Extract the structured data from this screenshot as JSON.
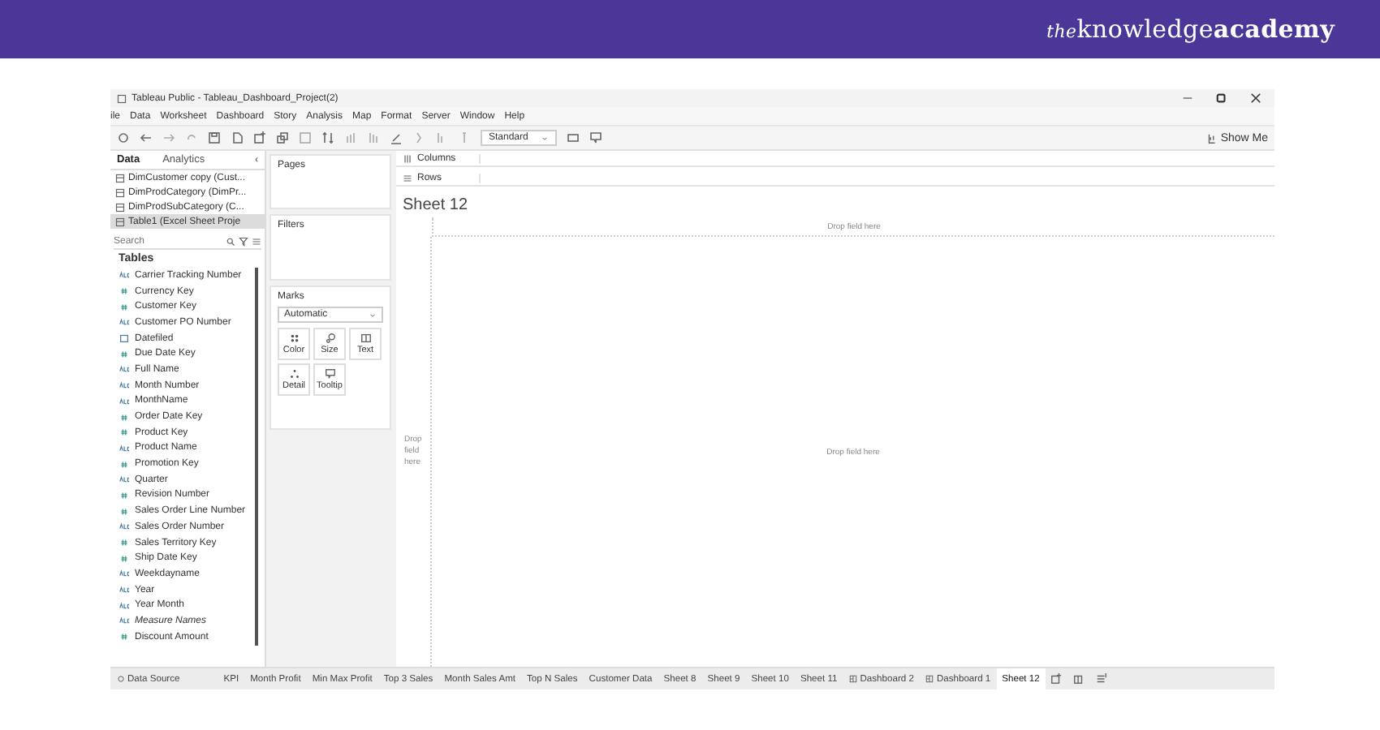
{
  "banner": {
    "logo": [
      {
        "text": "the",
        "kind": "italic"
      },
      {
        "text": "knowledge",
        "kind": "regular"
      },
      {
        "text": "academy",
        "kind": "bold"
      }
    ]
  },
  "window": {
    "title": "Tableau Public - Tableau_Dashboard_Project(2)"
  },
  "menu": [
    "ile",
    "Data",
    "Worksheet",
    "Dashboard",
    "Story",
    "Analysis",
    "Map",
    "Format",
    "Server",
    "Window",
    "Help"
  ],
  "toolbar": {
    "fit_dropdown": "Standard",
    "show_me": "Show Me"
  },
  "data_pane": {
    "tabs": [
      {
        "label": "Data",
        "selected": true
      },
      {
        "label": "Analytics",
        "selected": false
      }
    ],
    "collapse": "‹",
    "sources": [
      {
        "label": "DimCustomer copy (Cust...",
        "selected": false
      },
      {
        "label": "DimProdCategory (DimPr...",
        "selected": false
      },
      {
        "label": "DimProdSubCategory (C...",
        "selected": false
      },
      {
        "label": "Table1 (Excel Sheet Proje",
        "selected": true
      }
    ],
    "search": {
      "placeholder": "Search"
    },
    "tables_heading": "Tables",
    "fields": [
      {
        "label": "Carrier Tracking Number",
        "kind": "string"
      },
      {
        "label": "Currency Key",
        "kind": "number"
      },
      {
        "label": "Customer Key",
        "kind": "number"
      },
      {
        "label": "Customer PO Number",
        "kind": "string"
      },
      {
        "label": "Datefiled",
        "kind": "date"
      },
      {
        "label": "Due Date Key",
        "kind": "number"
      },
      {
        "label": "Full Name",
        "kind": "string"
      },
      {
        "label": "Month Number",
        "kind": "string"
      },
      {
        "label": "MonthName",
        "kind": "string"
      },
      {
        "label": "Order Date Key",
        "kind": "number"
      },
      {
        "label": "Product Key",
        "kind": "number"
      },
      {
        "label": "Product Name",
        "kind": "string"
      },
      {
        "label": "Promotion Key",
        "kind": "number"
      },
      {
        "label": "Quarter",
        "kind": "string"
      },
      {
        "label": "Revision Number",
        "kind": "number"
      },
      {
        "label": "Sales Order Line Number",
        "kind": "number"
      },
      {
        "label": "Sales Order Number",
        "kind": "string"
      },
      {
        "label": "Sales Territory Key",
        "kind": "number"
      },
      {
        "label": "Ship Date Key",
        "kind": "number"
      },
      {
        "label": "Weekdayname",
        "kind": "string"
      },
      {
        "label": "Year",
        "kind": "string"
      },
      {
        "label": "Year Month",
        "kind": "string"
      },
      {
        "label": "Measure Names",
        "kind": "measure-names"
      },
      {
        "label": "Discount Amount",
        "kind": "number"
      }
    ]
  },
  "cards": {
    "pages": "Pages",
    "filters": "Filters",
    "marks": {
      "title": "Marks",
      "mark_type": "Automatic",
      "buttons": [
        {
          "label": "Color",
          "kind": "color"
        },
        {
          "label": "Size",
          "kind": "size"
        },
        {
          "label": "Text",
          "kind": "text"
        },
        {
          "label": "Detail",
          "kind": "detail"
        },
        {
          "label": "Tooltip",
          "kind": "tooltip"
        }
      ]
    }
  },
  "shelves": [
    {
      "label": "Columns",
      "kind": "columns"
    },
    {
      "label": "Rows",
      "kind": "rows"
    }
  ],
  "view": {
    "title": "Sheet 12",
    "drop_top": "Drop field here",
    "drop_left": "Drop field here",
    "drop_center": "Drop field here"
  },
  "sheet_tabs": [
    {
      "label": "Data Source",
      "kind": "data-source",
      "selected": false
    },
    {
      "label": "KPI",
      "kind": "sheet",
      "selected": false
    },
    {
      "label": "Month Profit",
      "kind": "sheet",
      "selected": false
    },
    {
      "label": "Min Max Profit",
      "kind": "sheet",
      "selected": false
    },
    {
      "label": "Top 3 Sales",
      "kind": "sheet",
      "selected": false
    },
    {
      "label": "Month Sales Amt",
      "kind": "sheet",
      "selected": false
    },
    {
      "label": "Top N Sales",
      "kind": "sheet",
      "selected": false
    },
    {
      "label": "Customer Data",
      "kind": "sheet",
      "selected": false
    },
    {
      "label": "Sheet 8",
      "kind": "sheet",
      "selected": false
    },
    {
      "label": "Sheet 9",
      "kind": "sheet",
      "selected": false
    },
    {
      "label": "Sheet 10",
      "kind": "sheet",
      "selected": false
    },
    {
      "label": "Sheet 11",
      "kind": "sheet",
      "selected": false
    },
    {
      "label": "Dashboard 2",
      "kind": "dashboard",
      "selected": false
    },
    {
      "label": "Dashboard 1",
      "kind": "dashboard",
      "selected": false
    },
    {
      "label": "Sheet 12",
      "kind": "sheet",
      "selected": true
    }
  ]
}
